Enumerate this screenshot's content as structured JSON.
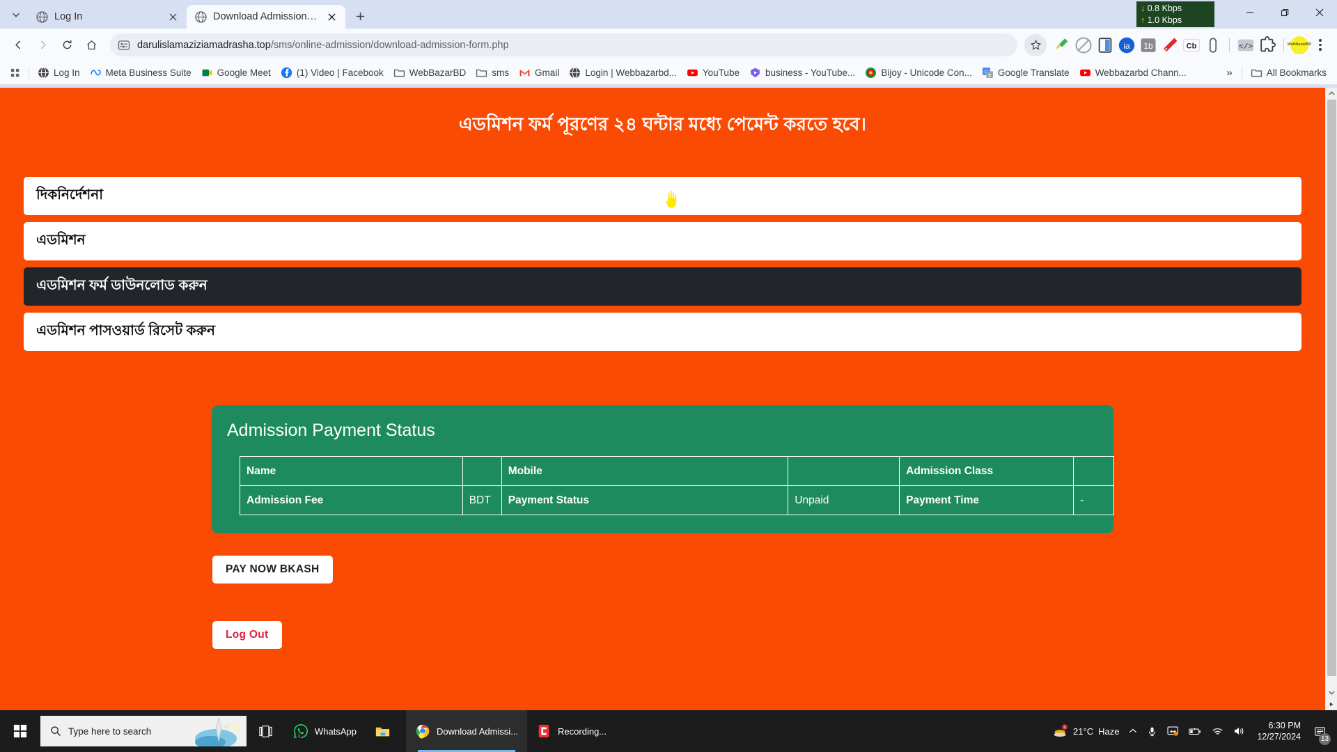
{
  "browser": {
    "tabs": [
      {
        "title": "Log In",
        "active": false,
        "favicon": "globe-icon"
      },
      {
        "title": "Download Admission Form",
        "active": true,
        "favicon": "globe-icon"
      }
    ],
    "new_tab_label": "+",
    "window_controls": {
      "minimize": "minimize-icon",
      "maximize": "restore-icon",
      "close": "close-icon"
    },
    "nav": {
      "back": "back-arrow-icon",
      "forward": "forward-arrow-icon",
      "reload": "reload-icon",
      "home": "home-icon"
    },
    "omnibox": {
      "site_icon": "page-info-icon",
      "url_domain": "darulislamaziziamadrasha.top",
      "url_path": "/sms/online-admission/download-admission-form.php",
      "bookmark_star": "star-icon"
    },
    "extensions": [
      {
        "name": "broom-icon",
        "label": ""
      },
      {
        "name": "block-icon",
        "label": ""
      },
      {
        "name": "sidepanel-icon",
        "label": ""
      },
      {
        "name": "ia-extension-icon",
        "label": "ia"
      },
      {
        "name": "1b-extension-icon",
        "label": "1b"
      },
      {
        "name": "pen-icon",
        "label": ""
      },
      {
        "name": "cb-extension-icon",
        "label": "Cb"
      },
      {
        "name": "capsule-icon",
        "label": ""
      },
      {
        "name": "code-icon",
        "label": "</>"
      },
      {
        "name": "puzzle-icon",
        "label": ""
      }
    ],
    "profile_initials": "WebBazarBD",
    "menu": "three-dot-menu-icon",
    "bookmarks": [
      {
        "label": "Log In",
        "icon": "globe-icon"
      },
      {
        "label": "Meta Business Suite",
        "icon": "meta-icon"
      },
      {
        "label": "Google Meet",
        "icon": "meet-icon"
      },
      {
        "label": "(1) Video | Facebook",
        "icon": "facebook-icon"
      },
      {
        "label": "WebBazarBD",
        "icon": "folder-icon"
      },
      {
        "label": "sms",
        "icon": "folder-icon"
      },
      {
        "label": "Gmail",
        "icon": "gmail-icon"
      },
      {
        "label": "Login | Webbazarbd...",
        "icon": "globe-icon"
      },
      {
        "label": "YouTube",
        "icon": "youtube-icon"
      },
      {
        "label": "business - YouTube...",
        "icon": "youtube-studio-icon"
      },
      {
        "label": "Bijoy - Unicode Con...",
        "icon": "bijoy-icon"
      },
      {
        "label": "Google Translate",
        "icon": "translate-icon"
      },
      {
        "label": "Webbazarbd Chann...",
        "icon": "youtube-icon"
      }
    ],
    "bookmarks_overflow": "»",
    "all_bookmarks_label": "All Bookmarks",
    "apps_grid": "apps-grid-icon"
  },
  "network_overlay": {
    "download": "0.8 Kbps",
    "upload": "1.0 Kbps",
    "down_arrow": "↓",
    "up_arrow": "↑"
  },
  "page": {
    "hero_notice": "এডমিশন ফর্ম পূরণের ২৪ ঘন্টার মধ্যে পেমেন্ট করতে হবে।",
    "accordion": [
      {
        "label": "দিকনির্দেশনা",
        "active": false
      },
      {
        "label": "এডমিশন",
        "active": false
      },
      {
        "label": "এডমিশন ফর্ম ডাউনলোড করুন",
        "active": true
      },
      {
        "label": "এডমিশন পাসওয়ার্ড রিসেট করুন",
        "active": false
      }
    ],
    "card": {
      "title": "Admission Payment Status",
      "rows": [
        [
          {
            "text": "Name",
            "bold": true
          },
          {
            "text": "",
            "bold": false
          },
          {
            "text": "Mobile",
            "bold": true
          },
          {
            "text": "",
            "bold": false
          },
          {
            "text": "Admission Class",
            "bold": true
          },
          {
            "text": "",
            "bold": false
          }
        ],
        [
          {
            "text": "Admission Fee",
            "bold": true
          },
          {
            "text": "BDT",
            "bold": false
          },
          {
            "text": "Payment Status",
            "bold": true
          },
          {
            "text": "Unpaid",
            "bold": false
          },
          {
            "text": "Payment Time",
            "bold": true
          },
          {
            "text": "-",
            "bold": false
          }
        ]
      ]
    },
    "pay_button": "PAY NOW BKASH",
    "logout_button": "Log Out",
    "colors": {
      "page_background": "#fa4b05",
      "card_background": "#1e8b5f",
      "active_accordion": "#22252a",
      "logout_text": "#e0213b"
    }
  },
  "taskbar": {
    "start": "windows-start-icon",
    "search_placeholder": "Type here to search",
    "task_view": "task-view-icon",
    "apps": [
      {
        "label": "WhatsApp",
        "icon": "whatsapp-icon",
        "active": false
      },
      {
        "label": "",
        "icon": "file-explorer-icon",
        "active": false
      },
      {
        "label": "Download Admissi...",
        "icon": "chrome-icon",
        "active": true
      },
      {
        "label": "Recording...",
        "icon": "recorder-icon",
        "active": false
      }
    ],
    "tray": {
      "weather_temp": "21°C",
      "weather_desc": "Haze",
      "chevron": "show-hidden-icons-icon",
      "mic": "microphone-icon",
      "screencast": "screen-icon",
      "battery": "battery-icon",
      "network": "wifi-icon",
      "volume": "speaker-icon",
      "time": "6:30 PM",
      "date": "12/27/2024",
      "notification_count": "13"
    }
  }
}
